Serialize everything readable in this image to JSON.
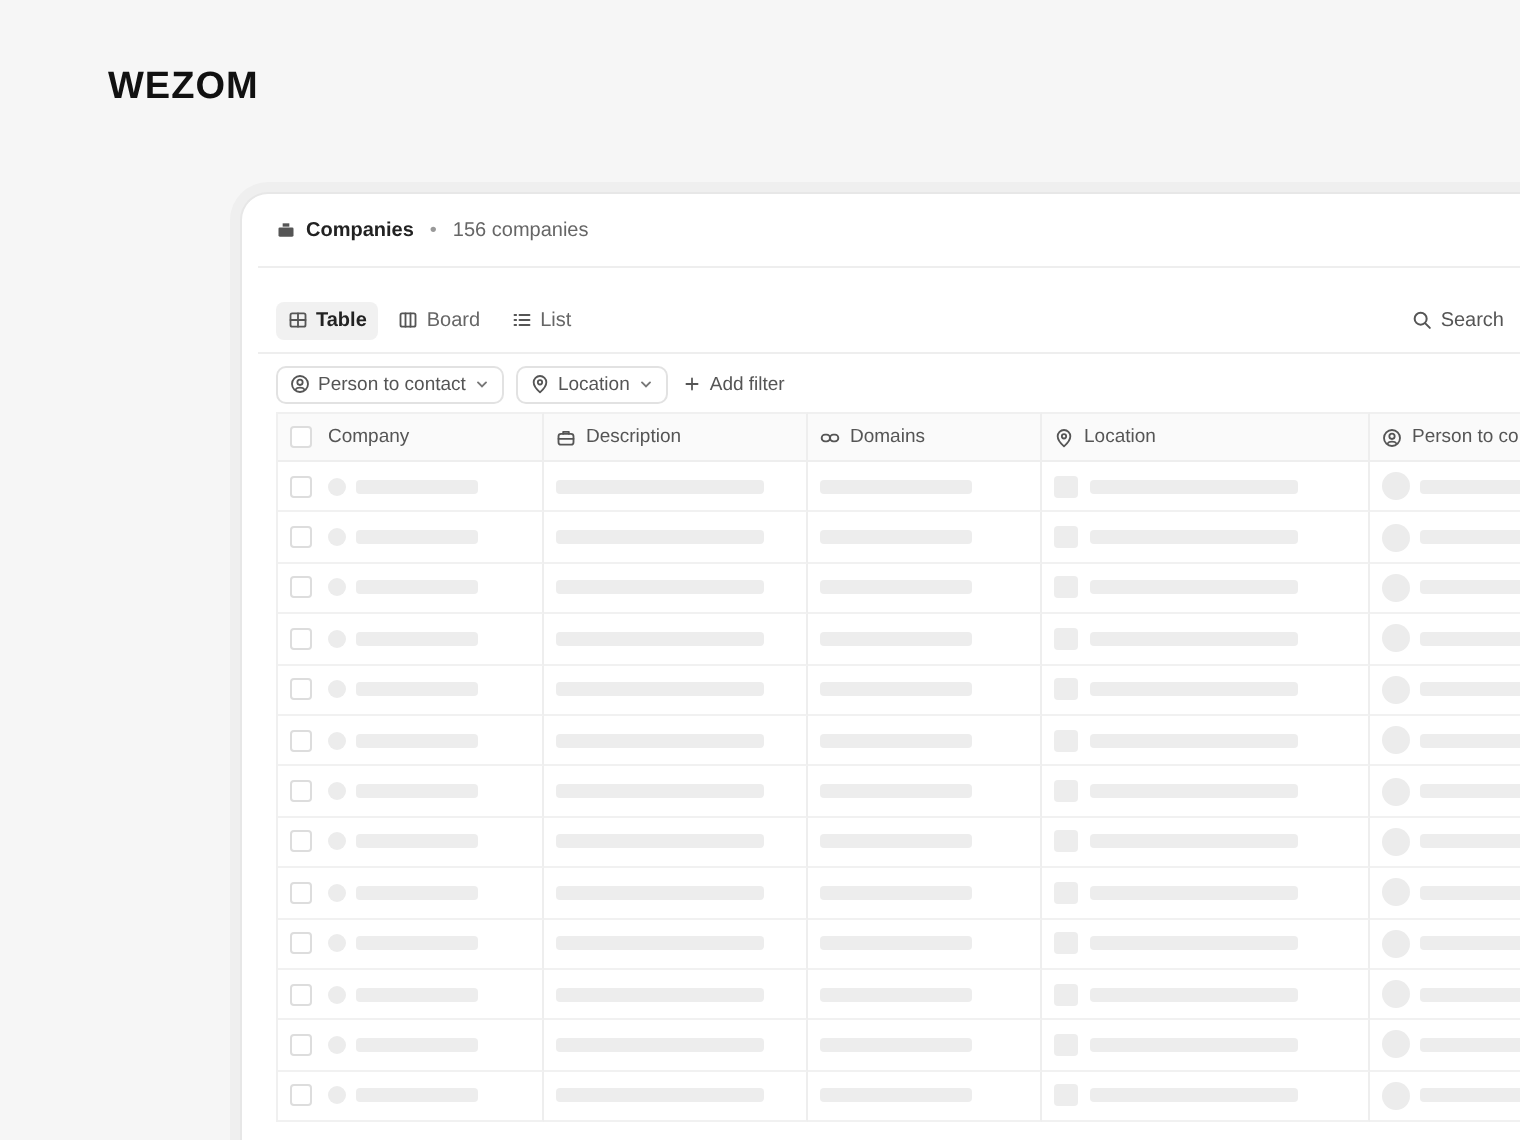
{
  "logo": {
    "text": "WEZOM"
  },
  "header": {
    "title": "Companies",
    "separator": "•",
    "count": "156 companies"
  },
  "views": [
    {
      "label": "Table",
      "kind": "table",
      "selected": true
    },
    {
      "label": "Board",
      "kind": "board",
      "selected": false
    },
    {
      "label": "List",
      "kind": "list",
      "selected": false
    }
  ],
  "search": {
    "label": "Search"
  },
  "filters": [
    {
      "label": "Person to contact",
      "kind": "person"
    },
    {
      "label": "Location",
      "kind": "location"
    }
  ],
  "add_filter": {
    "label": "Add filter"
  },
  "table": {
    "select_all": {
      "checked": false
    },
    "columns": [
      {
        "label": "Company",
        "kind": "company"
      },
      {
        "label": "Description",
        "kind": "description"
      },
      {
        "label": "Domains",
        "kind": "domains"
      },
      {
        "label": "Location",
        "kind": "location"
      },
      {
        "label": "Person to co",
        "kind": "person"
      }
    ],
    "rows": [
      {
        "checked": false
      },
      {
        "checked": false
      },
      {
        "checked": false
      },
      {
        "checked": false
      },
      {
        "checked": false
      },
      {
        "checked": false
      },
      {
        "checked": false
      },
      {
        "checked": false
      },
      {
        "checked": false
      },
      {
        "checked": false
      },
      {
        "checked": false
      },
      {
        "checked": false
      },
      {
        "checked": false
      }
    ]
  }
}
